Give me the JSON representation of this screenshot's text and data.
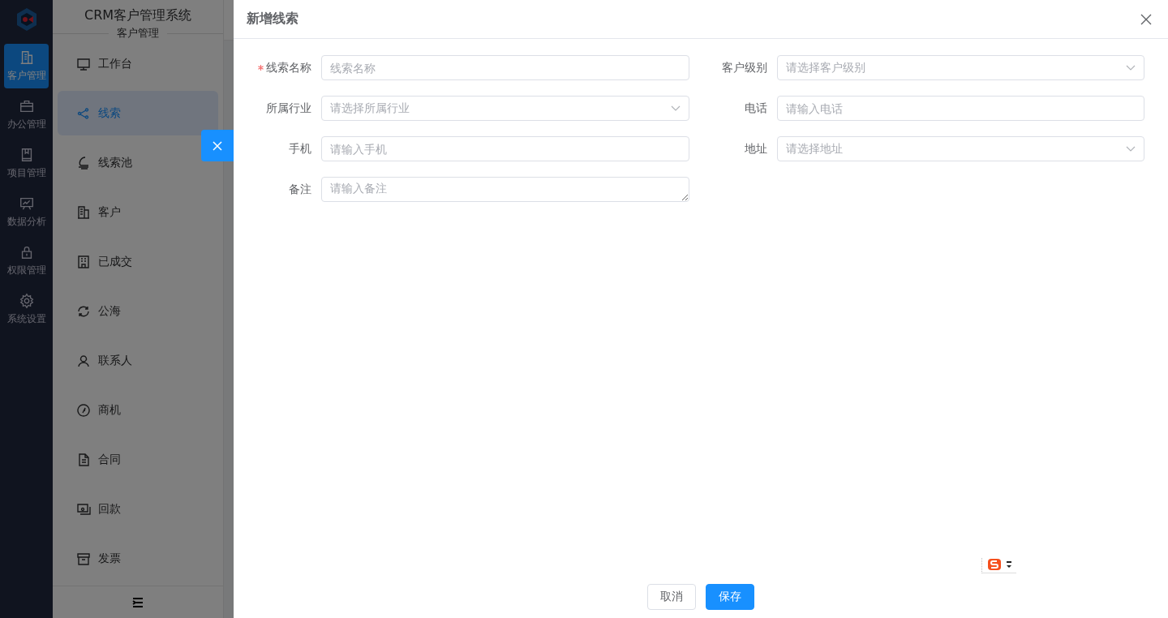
{
  "app_title": "CRM客户管理系统",
  "rail": [
    {
      "label": "客户管理",
      "selected": true
    },
    {
      "label": "办公管理",
      "selected": false
    },
    {
      "label": "项目管理",
      "selected": false
    },
    {
      "label": "数据分析",
      "selected": false
    },
    {
      "label": "权限管理",
      "selected": false
    },
    {
      "label": "系统设置",
      "selected": false
    }
  ],
  "sidebar": {
    "section": "客户管理",
    "items": [
      {
        "label": "工作台",
        "selected": false
      },
      {
        "label": "线索",
        "selected": true
      },
      {
        "label": "线索池",
        "selected": false
      },
      {
        "label": "客户",
        "selected": false
      },
      {
        "label": "已成交",
        "selected": false
      },
      {
        "label": "公海",
        "selected": false
      },
      {
        "label": "联系人",
        "selected": false
      },
      {
        "label": "商机",
        "selected": false
      },
      {
        "label": "合同",
        "selected": false
      },
      {
        "label": "回款",
        "selected": false
      },
      {
        "label": "发票",
        "selected": false
      }
    ]
  },
  "drawer": {
    "title": "新增线索",
    "fields": [
      {
        "label": "线索名称",
        "kind": "input",
        "required": true,
        "placeholder": "线索名称"
      },
      {
        "label": "客户级别",
        "kind": "select",
        "required": false,
        "placeholder": "请选择客户级别"
      },
      {
        "label": "所属行业",
        "kind": "select",
        "required": false,
        "placeholder": "请选择所属行业"
      },
      {
        "label": "电话",
        "kind": "input",
        "required": false,
        "placeholder": "请输入电话"
      },
      {
        "label": "手机",
        "kind": "input",
        "required": false,
        "placeholder": "请输入手机"
      },
      {
        "label": "地址",
        "kind": "select",
        "required": false,
        "placeholder": "请选择地址"
      },
      {
        "label": "备注",
        "kind": "textarea",
        "required": false,
        "placeholder": "请输入备注"
      }
    ],
    "buttons": [
      {
        "label": "取消",
        "kind": "default"
      },
      {
        "label": "保存",
        "kind": "primary"
      }
    ]
  }
}
